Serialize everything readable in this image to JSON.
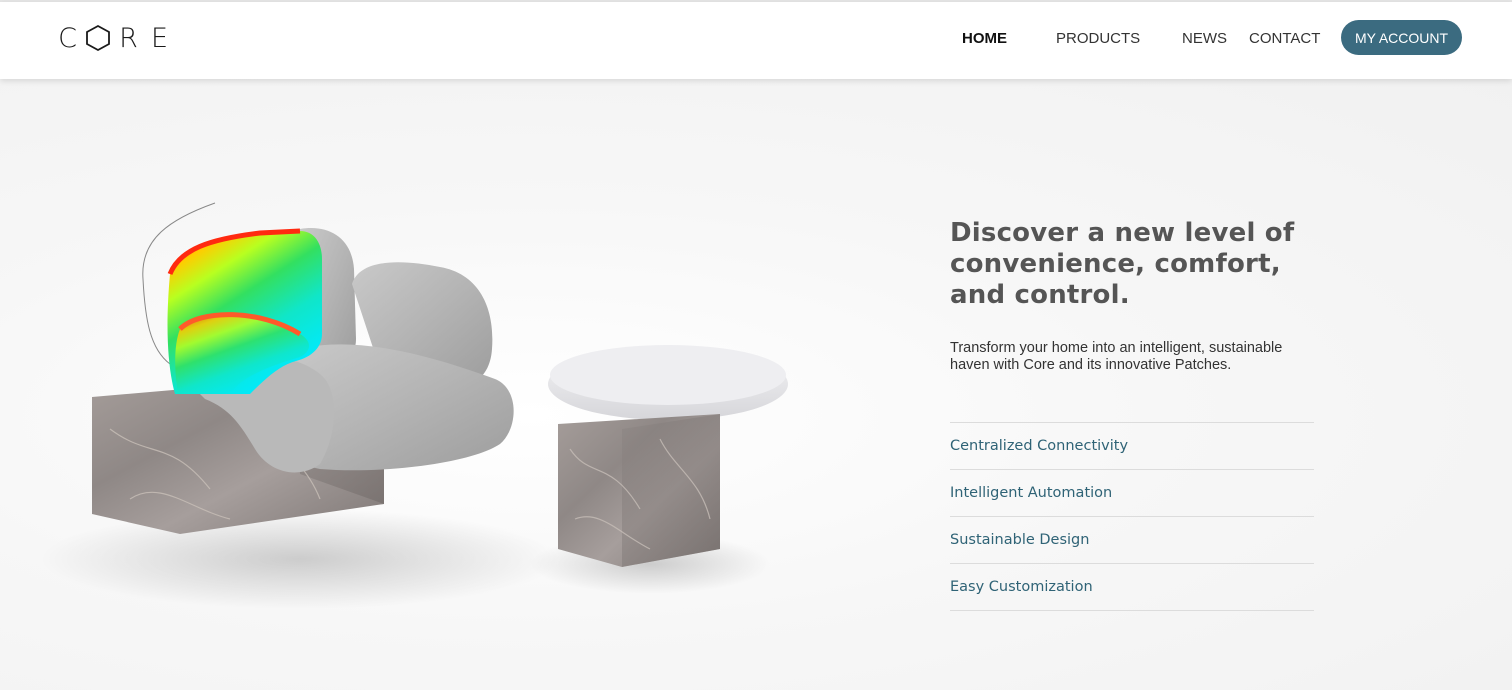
{
  "brand": {
    "letters": [
      "C",
      "R",
      "E"
    ]
  },
  "nav": {
    "home": "HOME",
    "products": "PRODUCTS",
    "news": "NEWS",
    "contact": "CONTACT",
    "account": "MY ACCOUNT"
  },
  "hero": {
    "headline_1": "Discover a new level of",
    "headline_2": "convenience, comfort,",
    "headline_3": "and control.",
    "subtext_1": "Transform your home into an intelligent, sustainable",
    "subtext_2": "haven with Core and its innovative Patches.",
    "image_icon": "lounge-chair-and-side-table-photo"
  },
  "features": [
    "Centralized Connectivity",
    "Intelligent Automation",
    "Sustainable Design",
    "Easy Customization"
  ],
  "colors": {
    "accent": "#3b6b80",
    "feature_text": "#2f6376",
    "headline": "#555555"
  }
}
